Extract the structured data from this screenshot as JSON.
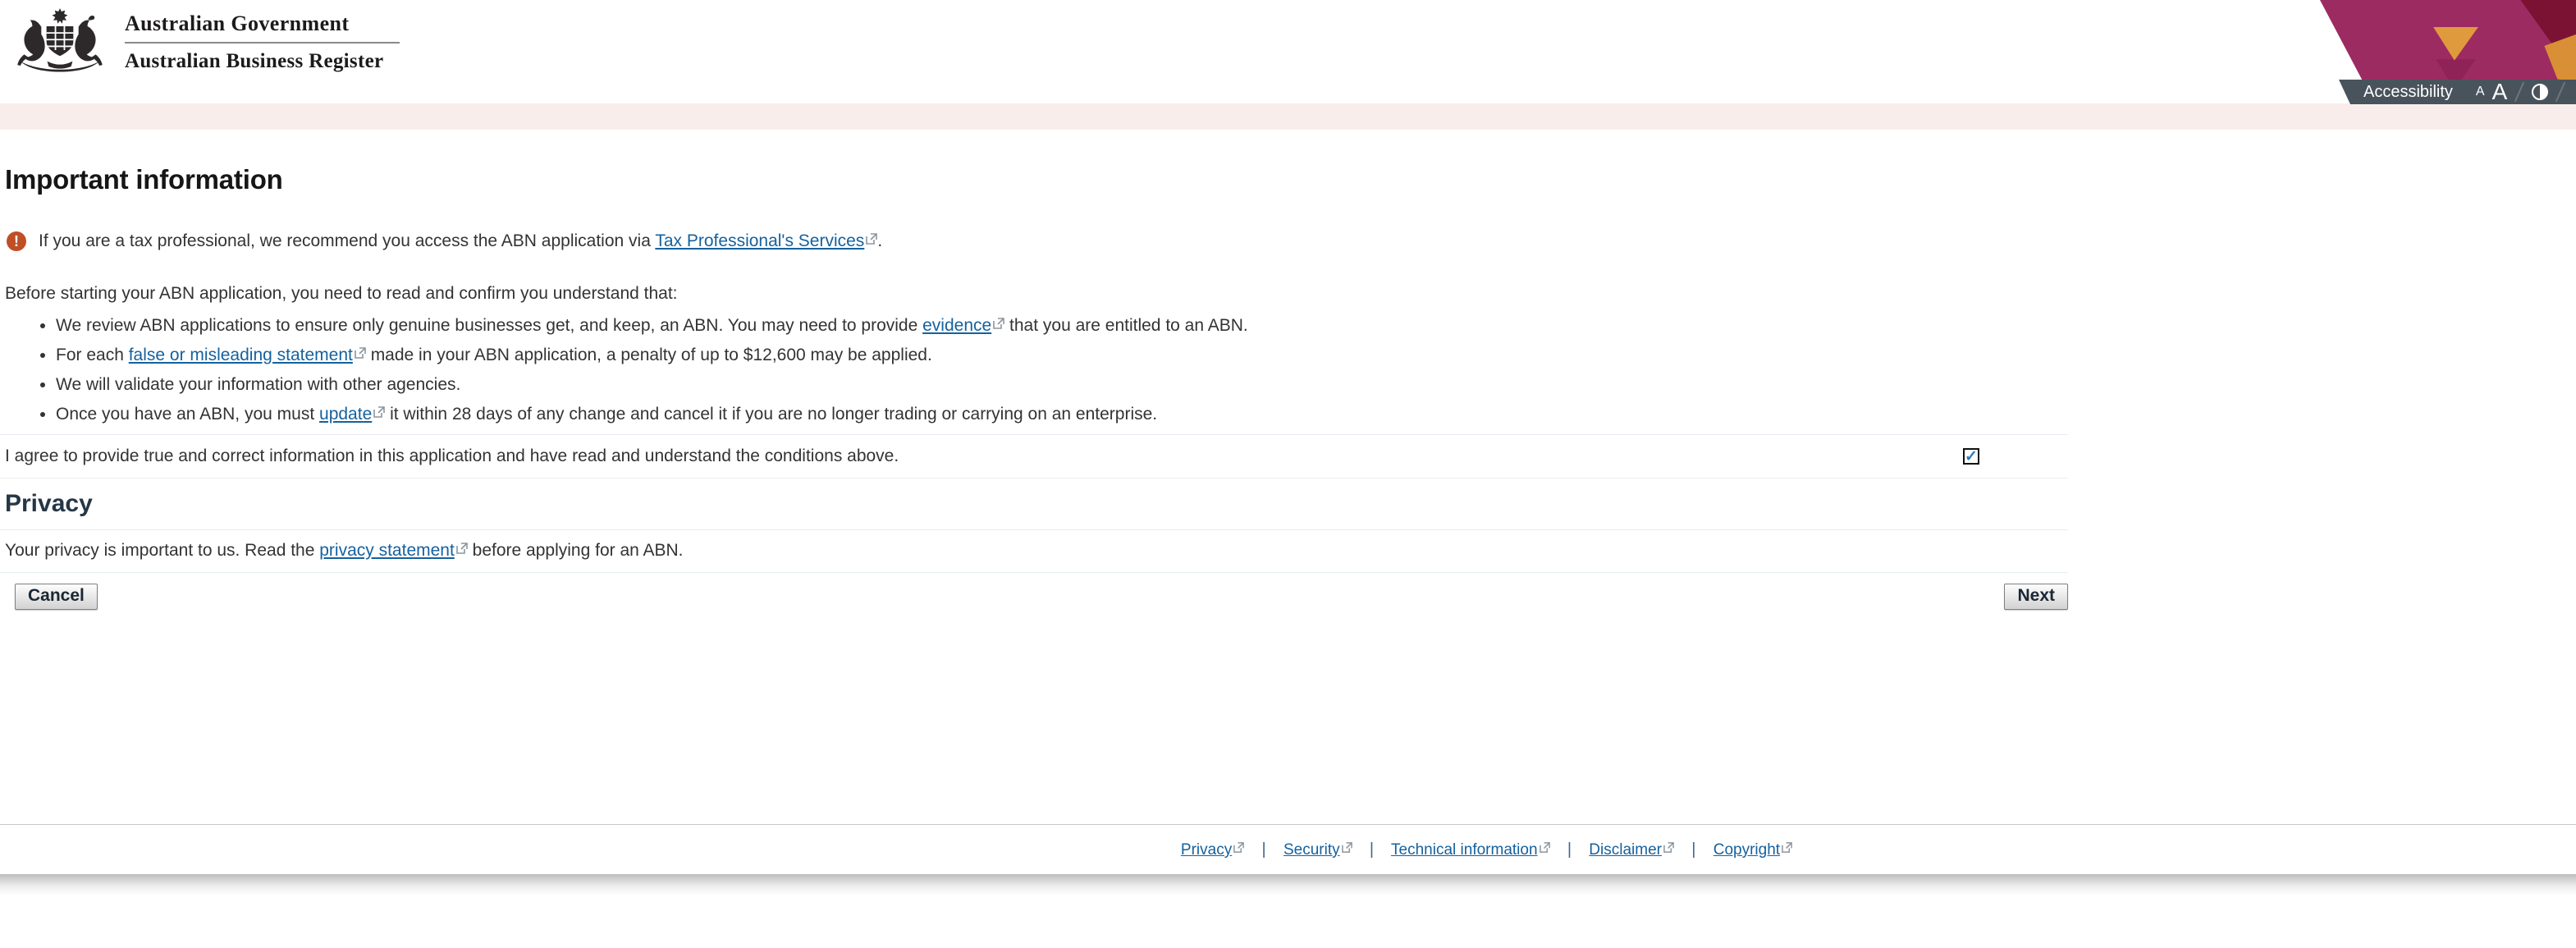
{
  "header": {
    "gov_title": "Australian Government",
    "register_title": "Australian Business Register",
    "accessibility": {
      "label": "Accessibility",
      "decrease_font": "A",
      "increase_font": "A"
    }
  },
  "main": {
    "title": "Important information",
    "warning": {
      "icon_glyph": "!",
      "pre": "If you are a tax professional, we recommend you access the ABN application via ",
      "link": "Tax Professional's Services",
      "post": "."
    },
    "intro": "Before starting your ABN application, you need to read and confirm you understand that:",
    "bullets": [
      {
        "pre": "We review ABN applications to ensure only genuine businesses get, and keep, an ABN. You may need to provide ",
        "link": "evidence",
        "post": " that you are entitled to an ABN."
      },
      {
        "pre": "For each ",
        "link": "false or misleading statement",
        "post": " made in your ABN application, a penalty of up to $12,600 may be applied."
      },
      {
        "pre": "We will validate your information with other agencies.",
        "link": "",
        "post": ""
      },
      {
        "pre": "Once you have an ABN, you must ",
        "link": "update",
        "post": " it within 28 days of any change and cancel it if you are no longer trading or carrying on an enterprise."
      }
    ],
    "agreement": {
      "text": "I agree to provide true and correct information in this application and have read and understand the conditions above.",
      "checked": true,
      "check_glyph": "✓"
    },
    "privacy": {
      "heading": "Privacy",
      "pre": "Your privacy is important to us. Read the ",
      "link": "privacy statement",
      "post": " before applying for an ABN."
    },
    "actions": {
      "cancel": "Cancel",
      "next": "Next"
    }
  },
  "footer": {
    "separator": "|",
    "links": [
      "Privacy",
      "Security",
      "Technical information",
      "Disclaimer",
      "Copyright"
    ]
  },
  "colors": {
    "magenta": "#9c2b61",
    "maroon": "#7b1233",
    "orange": "#e09a3e",
    "a11y_bar": "#49535c",
    "subheader_strip": "#f9edeb",
    "link": "#15619e",
    "warning": "#bf4f26",
    "check": "#2b78c5"
  }
}
